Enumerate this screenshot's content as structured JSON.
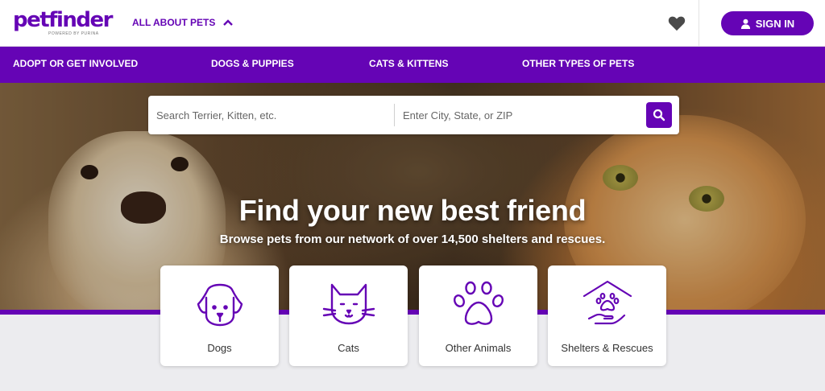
{
  "brand": {
    "logo_text": "petfinder",
    "logo_sub": "POWERED BY PURINA"
  },
  "header": {
    "about_label": "ALL ABOUT PETS",
    "signin_label": "SIGN IN"
  },
  "nav": {
    "items": [
      "ADOPT OR GET INVOLVED",
      "DOGS & PUPPIES",
      "CATS & KITTENS",
      "OTHER TYPES OF PETS"
    ]
  },
  "search": {
    "pet_placeholder": "Search Terrier, Kitten, etc.",
    "location_placeholder": "Enter City, State, or ZIP"
  },
  "hero": {
    "headline": "Find your new best friend",
    "subline": "Browse pets from our network of over 14,500 shelters and rescues."
  },
  "cards": [
    {
      "label": "Dogs",
      "icon": "dog-icon"
    },
    {
      "label": "Cats",
      "icon": "cat-icon"
    },
    {
      "label": "Other Animals",
      "icon": "paw-icon"
    },
    {
      "label": "Shelters & Rescues",
      "icon": "shelter-icon"
    }
  ],
  "colors": {
    "brand": "#6504b5",
    "nav_text": "#ffffff",
    "page_bg": "#ececef"
  }
}
